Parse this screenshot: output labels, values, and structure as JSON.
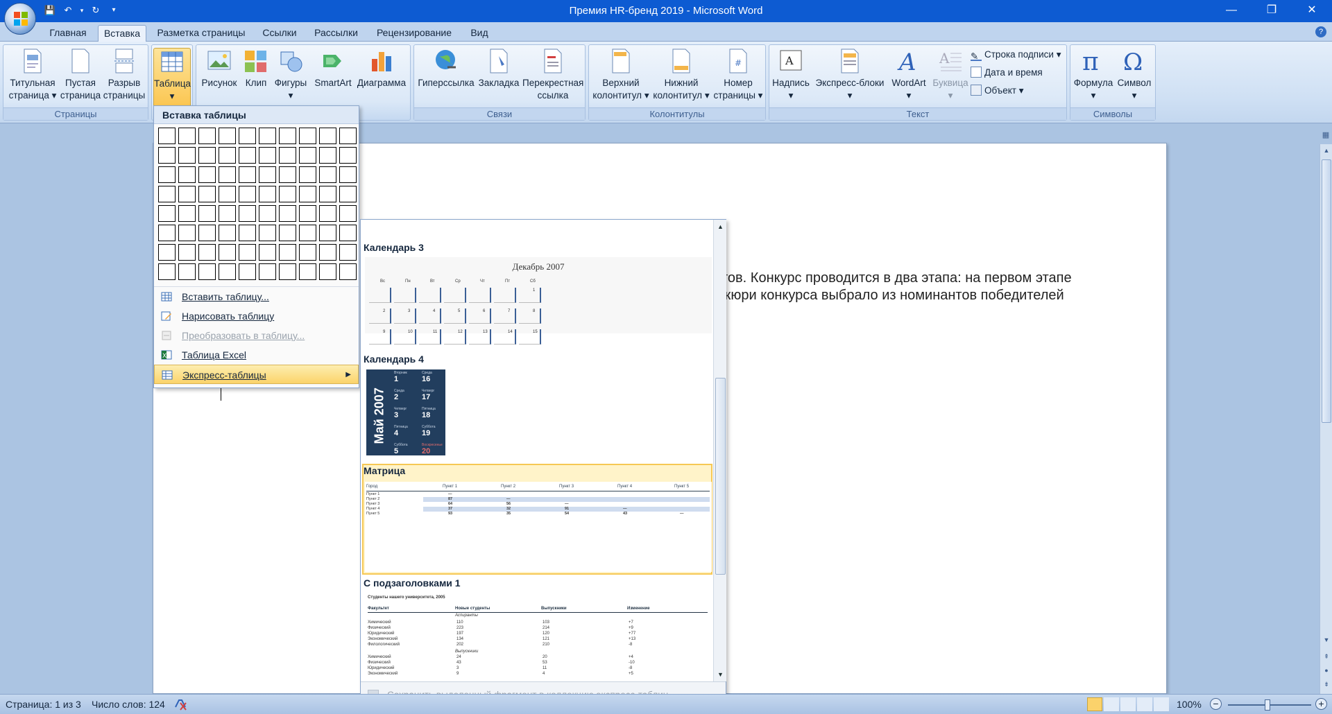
{
  "window": {
    "title": "Премия HR-бренд 2019 - Microsoft Word",
    "controls": [
      "—",
      "❐",
      "✕"
    ]
  },
  "tabs": [
    "Главная",
    "Вставка",
    "Разметка страницы",
    "Ссылки",
    "Рассылки",
    "Рецензирование",
    "Вид"
  ],
  "active_tab": "Вставка",
  "ribbon": {
    "pages": {
      "label": "Страницы",
      "title_page": [
        "Титульная",
        "страница"
      ],
      "blank_page": [
        "Пустая",
        "страница"
      ],
      "page_break": [
        "Разрыв",
        "страницы"
      ]
    },
    "tables": {
      "label": "Таблица"
    },
    "illustrations": {
      "picture": "Рисунок",
      "clip": "Клип",
      "shapes": "Фигуры",
      "smartart": "SmartArt",
      "chart": "Диаграмма"
    },
    "links": {
      "label": "Связи",
      "hyperlink": "Гиперссылка",
      "bookmark": "Закладка",
      "cross_ref": [
        "Перекрестная",
        "ссылка"
      ]
    },
    "header_footer": {
      "label": "Колонтитулы",
      "header": [
        "Верхний",
        "колонтитул"
      ],
      "footer": [
        "Нижний",
        "колонтитул"
      ],
      "page_number": [
        "Номер",
        "страницы"
      ]
    },
    "text": {
      "label": "Текст",
      "textbox": "Надпись",
      "quickparts": "Экспресс-блоки",
      "wordart": "WordArt",
      "dropcap": "Буквица",
      "signature": "Строка подписи",
      "datetime": "Дата и время",
      "object": "Объект"
    },
    "symbols": {
      "label": "Символы",
      "formula": "Формула",
      "symbol": "Символ"
    }
  },
  "insert_table_menu": {
    "header": "Вставка таблицы",
    "grid_rows": 8,
    "grid_cols": 10,
    "items": [
      {
        "label": "Вставить таблицу...",
        "disabled": false
      },
      {
        "label": "Нарисовать таблицу",
        "disabled": false
      },
      {
        "label": "Преобразовать в таблицу...",
        "disabled": true
      },
      {
        "label": "Таблица Excel",
        "disabled": false
      },
      {
        "label": "Экспресс-таблицы",
        "disabled": false,
        "highlighted": true
      }
    ]
  },
  "gallery": {
    "items": [
      "Календарь 3",
      "Календарь 4",
      "Матрица",
      "С подзаголовками 1"
    ],
    "selected": "Матрица",
    "calendar3": {
      "month": "Декабрь 2007",
      "days": [
        "Вс",
        "Пн",
        "Вт",
        "Ср",
        "Чт",
        "Пт",
        "Сб"
      ],
      "rows": [
        [
          "",
          "",
          "",
          "",
          "",
          "",
          "1"
        ],
        [
          "2",
          "3",
          "4",
          "5",
          "6",
          "7",
          "8"
        ],
        [
          "9",
          "10",
          "11",
          "12",
          "13",
          "14",
          "15"
        ]
      ]
    },
    "calendar4": {
      "month": "Май 2007",
      "left": [
        [
          "Вторник",
          "1"
        ],
        [
          "Среда",
          "2"
        ],
        [
          "Четверг",
          "3"
        ],
        [
          "Пятница",
          "4"
        ],
        [
          "Суббота",
          "5"
        ]
      ],
      "right": [
        [
          "Среда",
          "16"
        ],
        [
          "Четверг",
          "17"
        ],
        [
          "Пятница",
          "18"
        ],
        [
          "Суббота",
          "19"
        ],
        [
          "Воскресенье",
          "20"
        ]
      ]
    },
    "matrix": {
      "header": [
        "Город",
        "Пункт 1",
        "Пункт 2",
        "Пункт 3",
        "Пункт 4",
        "Пункт 5"
      ],
      "rows": [
        [
          "Пункт 1",
          "—",
          "",
          "",
          "",
          ""
        ],
        [
          "Пункт 2",
          "87",
          "—",
          "",
          "",
          ""
        ],
        [
          "Пункт 3",
          "64",
          "56",
          "—",
          "",
          ""
        ],
        [
          "Пункт 4",
          "37",
          "32",
          "91",
          "—",
          ""
        ],
        [
          "Пункт 5",
          "93",
          "35",
          "54",
          "43",
          "—"
        ]
      ]
    },
    "subheadings": {
      "caption": "Студенты нашего университета, 2005",
      "header": [
        "Факультет",
        "Новые студенты",
        "Выпускники",
        "Изменение"
      ],
      "section1": "Аспиранты",
      "rows1": [
        [
          "Химический",
          "110",
          "103",
          "+7"
        ],
        [
          "Физический",
          "223",
          "214",
          "+9"
        ],
        [
          "Юридический",
          "197",
          "120",
          "+77"
        ],
        [
          "Экономический",
          "134",
          "121",
          "+13"
        ],
        [
          "Филологический",
          "202",
          "210",
          "-8"
        ]
      ],
      "section2": "Выпускники",
      "rows2": [
        [
          "Химический",
          "24",
          "20",
          "+4"
        ],
        [
          "Физический",
          "43",
          "53",
          "-10"
        ],
        [
          "Юридический",
          "3",
          "11",
          "-8"
        ],
        [
          "Экономический",
          "9",
          "4",
          "+5"
        ]
      ]
    },
    "footer": "Сохранить выделенный фрагмент в коллекцию экспресс-таблиц..."
  },
  "document": {
    "line1": "тов. Конкурс проводится в два этапа: на первом этапе",
    "line2": "жюри конкурса выбрало из номинантов победителей"
  },
  "status": {
    "page": "Страница: 1 из 3",
    "words": "Число слов: 124",
    "zoom": "100%"
  }
}
